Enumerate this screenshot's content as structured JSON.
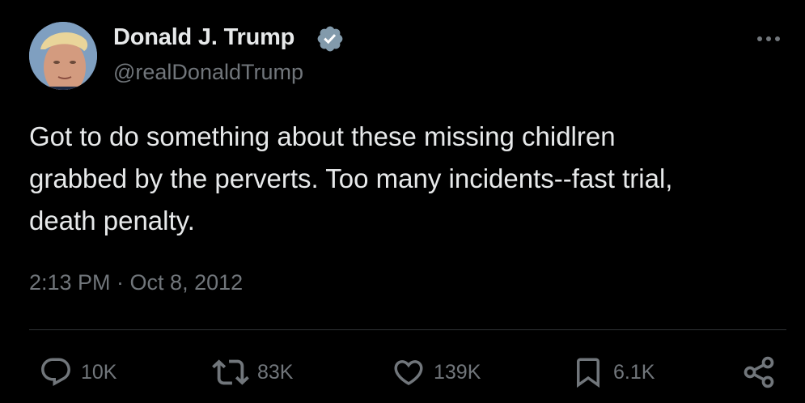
{
  "tweet": {
    "author": {
      "display_name": "Donald J. Trump",
      "handle": "@realDonaldTrump",
      "verified": true,
      "verified_color": "#829aab"
    },
    "text": "Got to do something about these missing chidlren\ngrabbed by the perverts. Too many incidents--fast trial,\ndeath penalty.",
    "timestamp": "2:13 PM · Oct 8, 2012",
    "actions": {
      "reply": {
        "icon": "reply-icon",
        "count": "10K"
      },
      "retweet": {
        "icon": "retweet-icon",
        "count": "83K"
      },
      "like": {
        "icon": "heart-icon",
        "count": "139K"
      },
      "bookmark": {
        "icon": "bookmark-icon",
        "count": "6.1K"
      },
      "share": {
        "icon": "share-icon"
      }
    }
  },
  "colors": {
    "background": "#000000",
    "primary_text": "#e7e9ea",
    "secondary_text": "#71767b",
    "divider": "#2f3336"
  }
}
